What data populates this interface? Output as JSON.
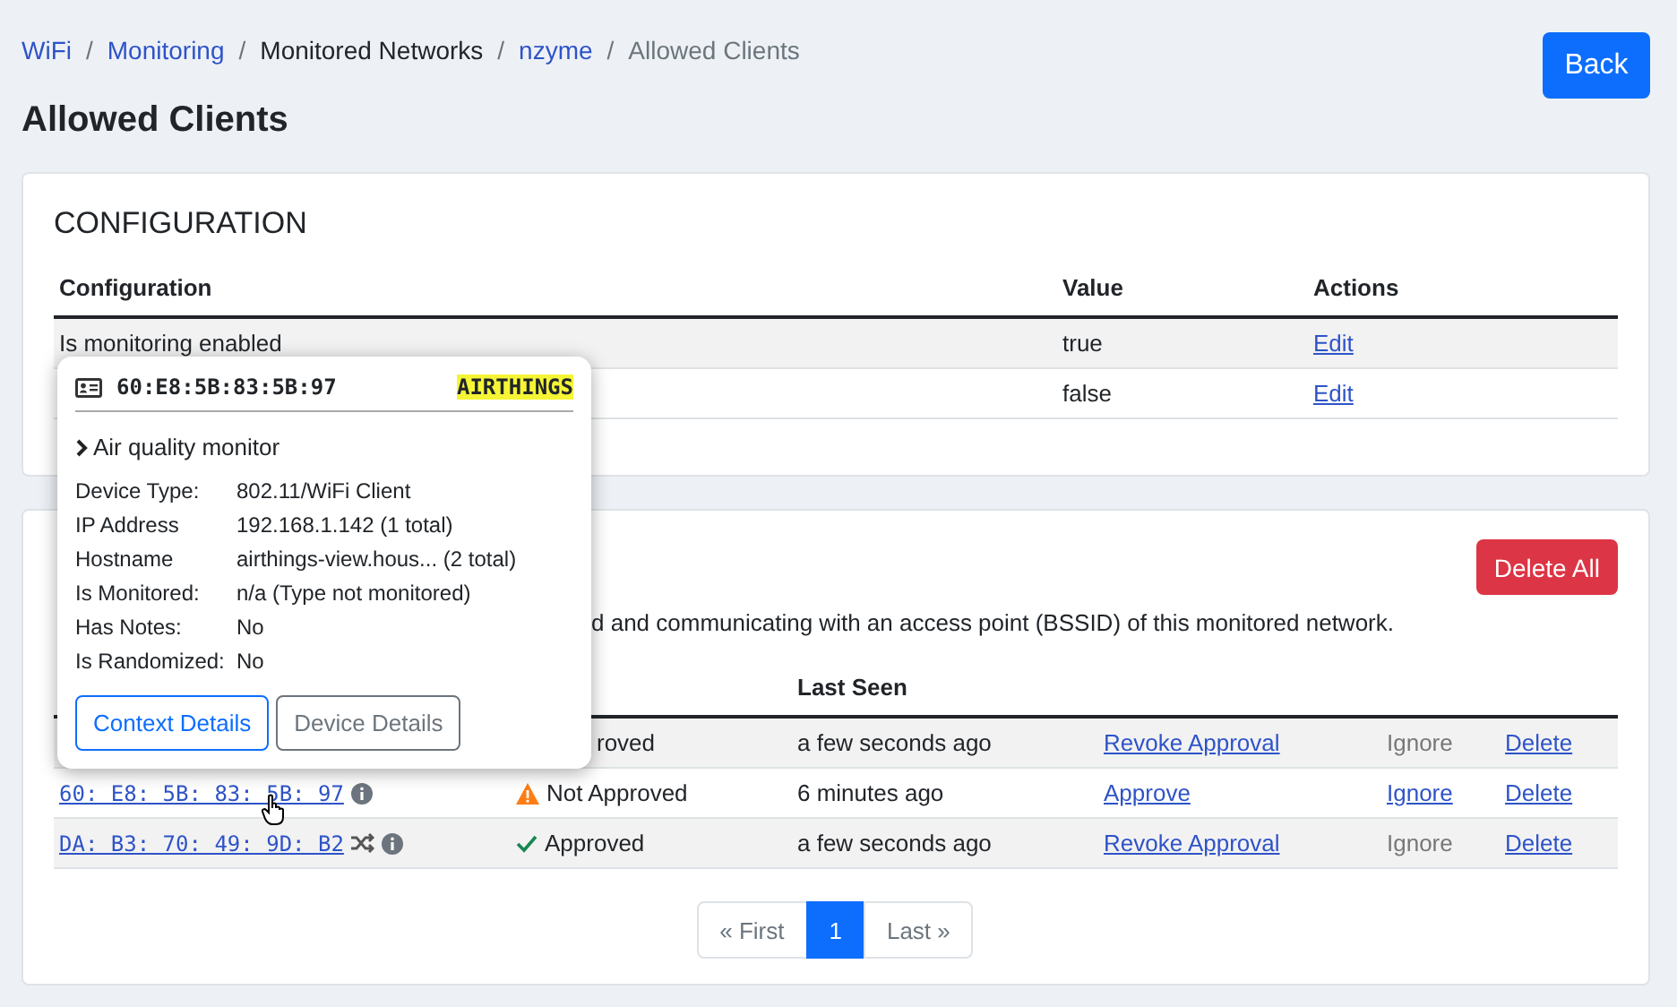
{
  "breadcrumb": [
    {
      "label": "WiFi",
      "kind": "link"
    },
    {
      "label": "/",
      "kind": "separator"
    },
    {
      "label": "Monitoring",
      "kind": "link"
    },
    {
      "label": "/",
      "kind": "separator"
    },
    {
      "label": "Monitored Networks",
      "kind": "text"
    },
    {
      "label": "/",
      "kind": "separator"
    },
    {
      "label": "nzyme",
      "kind": "link"
    },
    {
      "label": "/",
      "kind": "separator"
    },
    {
      "label": "Allowed Clients",
      "kind": "current"
    }
  ],
  "back_button": "Back",
  "title": "Allowed Clients",
  "configuration": {
    "heading": "CONFIGURATION",
    "columns": [
      "Configuration",
      "Value",
      "Actions"
    ],
    "rows": [
      {
        "name": "Is monitoring enabled",
        "value": "true",
        "action": "Edit"
      },
      {
        "value": "false",
        "action": "Edit"
      }
    ]
  },
  "clients": {
    "delete_all": "Delete All",
    "description": "d and communicating with an access point (BSSID) of this monitored network.",
    "columns": [
      "Last Seen"
    ],
    "rows": [
      {
        "status": {
          "text": "roved"
        },
        "last_seen": "a few seconds ago",
        "action": "Revoke Approval",
        "ignore": {
          "label": "Ignore",
          "disabled": true
        },
        "delete": "Delete"
      },
      {
        "mac": "60: E8: 5B: 83: 5B: 97",
        "randomized": false,
        "status": {
          "kind": "not_approved",
          "text": "Not Approved"
        },
        "last_seen": "6 minutes ago",
        "action": "Approve",
        "ignore": {
          "label": "Ignore",
          "disabled": false
        },
        "delete": "Delete"
      },
      {
        "mac": "DA: B3: 70: 49: 9D: B2",
        "randomized": true,
        "status": {
          "kind": "approved",
          "text": "Approved"
        },
        "last_seen": "a few seconds ago",
        "action": "Revoke Approval",
        "ignore": {
          "label": "Ignore",
          "disabled": true
        },
        "delete": "Delete"
      }
    ]
  },
  "pagination": [
    {
      "label": "« First",
      "selected": false
    },
    {
      "label": "1",
      "selected": true
    },
    {
      "label": "Last »",
      "selected": false
    }
  ],
  "popover": {
    "mac": "60:E8:5B:83:5B:97",
    "tag": "AIRTHINGS",
    "subtitle": "Air quality monitor",
    "details": [
      {
        "label": "Device Type:",
        "value": "802.11/WiFi Client"
      },
      {
        "label": "IP Address",
        "value": "192.168.1.142 (1 total)"
      },
      {
        "label": "Hostname",
        "value": "airthings-view.hous... (2 total)"
      },
      {
        "label": "Is Monitored:",
        "value": "n/a (Type not monitored)"
      },
      {
        "label": "Has Notes:",
        "value": "No"
      },
      {
        "label": "Is Randomized:",
        "value": "No"
      }
    ],
    "buttons": [
      {
        "label": "Context Details",
        "kind": "primary"
      },
      {
        "label": "Device Details",
        "kind": "secondary"
      }
    ]
  }
}
